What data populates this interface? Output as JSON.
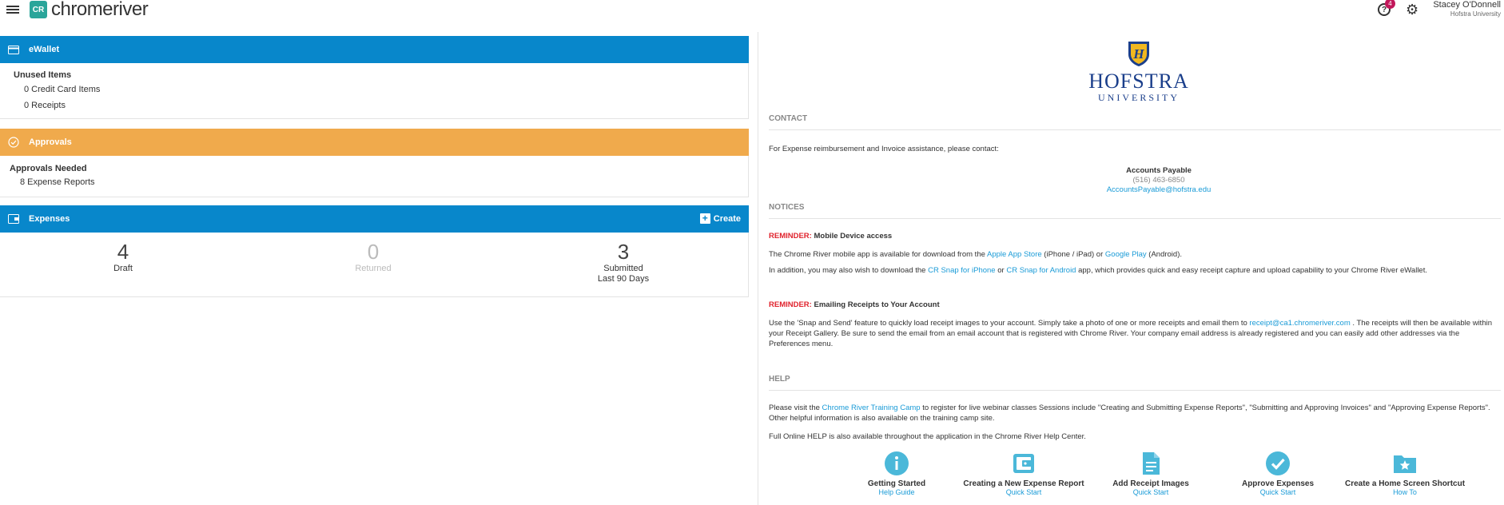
{
  "brand": {
    "logo_text": "chromeriver",
    "badge_text": "CR"
  },
  "header": {
    "help_count": "4",
    "user_name": "Stacey O'Donnell",
    "user_org": "Hofstra University"
  },
  "ewallet": {
    "title": "eWallet",
    "unused_title": "Unused Items",
    "credit_card_items": "0 Credit Card Items",
    "receipts": "0 Receipts"
  },
  "approvals": {
    "title": "Approvals",
    "needed_title": "Approvals Needed",
    "expense_reports": "8 Expense Reports"
  },
  "expenses": {
    "title": "Expenses",
    "create_label": "Create",
    "stats": [
      {
        "value": "4",
        "label": "Draft",
        "sub": ""
      },
      {
        "value": "0",
        "label": "Returned",
        "sub": ""
      },
      {
        "value": "3",
        "label": "Submitted",
        "sub": "Last 90 Days"
      }
    ]
  },
  "university": {
    "name": "HOFSTRA",
    "sub": "UNIVERSITY"
  },
  "contact": {
    "title": "CONTACT",
    "intro": "For Expense reimbursement and Invoice assistance, please contact:",
    "dept": "Accounts Payable",
    "phone": "(516) 463-6850",
    "email": "AccountsPayable@hofstra.edu"
  },
  "notices": {
    "title": "NOTICES",
    "r1_label": "REMINDER:",
    "r1_title": "Mobile Device access",
    "r1_p1_a": "The Chrome River mobile app is available for download from the ",
    "r1_p1_link1": "Apple App Store",
    "r1_p1_b": " (iPhone / iPad) or ",
    "r1_p1_link2": "Google Play",
    "r1_p1_c": " (Android).",
    "r1_p2_a": "In addition, you may also wish to download the ",
    "r1_p2_link1": "CR Snap for iPhone",
    "r1_p2_b": " or ",
    "r1_p2_link2": "CR Snap for Android",
    "r1_p2_c": " app, which provides quick and easy receipt capture and upload capability to your Chrome River eWallet.",
    "r2_label": "REMINDER:",
    "r2_title": "Emailing Receipts to Your Account",
    "r2_p_a": "Use the 'Snap and Send' feature to quickly load receipt images to your account. Simply take a photo of one or more receipts and email them to ",
    "r2_p_link": "receipt@ca1.chromeriver.com",
    "r2_p_b": " . The receipts will then be available within your Receipt Gallery.  Be sure to send the email from an email account that is registered with Chrome River.  Your company email address is already registered and you can easily add other addresses via the Preferences menu."
  },
  "help": {
    "title": "HELP",
    "p1_a": "Please visit the ",
    "p1_link": "Chrome River Training Camp",
    "p1_b": " to register for live webinar classes  Sessions include \"Creating and Submitting Expense Reports\", \"Submitting and Approving Invoices\" and \"Approving Expense Reports\". Other helpful information is also available on the training camp site.",
    "p2": "Full Online HELP is also available throughout the application in the Chrome River Help Center.",
    "links": [
      {
        "title": "Getting Started",
        "sub": "Help Guide",
        "icon": "info-icon"
      },
      {
        "title": "Creating a New Expense Report",
        "sub": "Quick Start",
        "icon": "wallet-icon"
      },
      {
        "title": "Add Receipt Images",
        "sub": "Quick Start",
        "icon": "document-icon"
      },
      {
        "title": "Approve Expenses",
        "sub": "Quick Start",
        "icon": "checkmark-icon"
      },
      {
        "title": "Create a Home Screen Shortcut",
        "sub": "How To",
        "icon": "folder-star-icon"
      }
    ]
  },
  "colors": {
    "primary": "#0887cb",
    "approvals": "#f0aa4c",
    "link": "#1a9bd7",
    "reminder": "#e0232d",
    "brand": "#2aa59a",
    "help_icon": "#4bb8d9"
  }
}
